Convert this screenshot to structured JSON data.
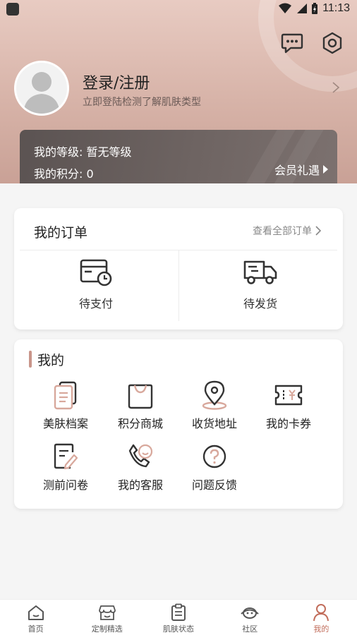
{
  "status_bar": {
    "time": "11:13"
  },
  "profile": {
    "title": "登录/注册",
    "subtitle": "立即登陆检测了解肌肤类型"
  },
  "member": {
    "level": "我的等级: 暂无等级",
    "points": "我的积分: 0",
    "benefit_link": "会员礼遇"
  },
  "orders": {
    "title": "我的订单",
    "view_all": "查看全部订单",
    "items": [
      {
        "label": "待支付",
        "icon": "card-clock-icon"
      },
      {
        "label": "待发货",
        "icon": "delivery-truck-icon"
      }
    ]
  },
  "mine": {
    "title": "我的",
    "items": [
      {
        "label": "美肤档案",
        "icon": "document-icon"
      },
      {
        "label": "积分商城",
        "icon": "shopping-bag-icon"
      },
      {
        "label": "收货地址",
        "icon": "location-pin-icon"
      },
      {
        "label": "我的卡券",
        "icon": "coupon-icon"
      },
      {
        "label": "测前问卷",
        "icon": "questionnaire-icon"
      },
      {
        "label": "我的客服",
        "icon": "customer-service-icon"
      },
      {
        "label": "问题反馈",
        "icon": "help-icon"
      }
    ]
  },
  "bottom_nav": {
    "items": [
      {
        "label": "首页",
        "icon": "home-icon"
      },
      {
        "label": "定制精选",
        "icon": "store-icon"
      },
      {
        "label": "肌肤状态",
        "icon": "clipboard-icon"
      },
      {
        "label": "社区",
        "icon": "community-icon"
      },
      {
        "label": "我的",
        "icon": "user-icon"
      }
    ],
    "active_index": 4
  },
  "colors": {
    "header_gradient_top": "#e8cbc2",
    "header_gradient_bottom": "#c9a196",
    "member_card": "#5f5655",
    "accent": "#c26e5c",
    "icon_line": "#333333",
    "icon_accent": "#d8a89c"
  }
}
